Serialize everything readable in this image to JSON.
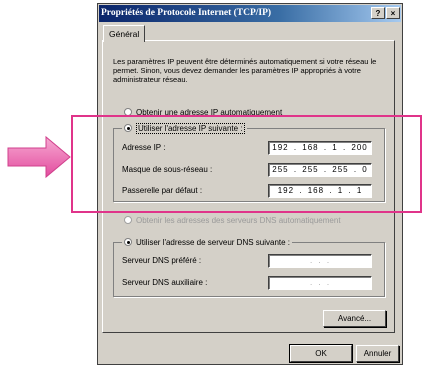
{
  "window": {
    "title": "Propriétés de Protocole Internet (TCP/IP)",
    "help_btn": "?",
    "close_btn": "×"
  },
  "tab": {
    "label": "Général"
  },
  "description": "Les paramètres IP peuvent être déterminés automatiquement si votre réseau le permet. Sinon, vous devez demander les paramètres IP appropriés à votre administrateur réseau.",
  "ip_mode": {
    "auto_label": "Obtenir une adresse IP automatiquement",
    "manual_label": "Utiliser l'adresse IP suivante :",
    "selected": "manual"
  },
  "ip_fields": {
    "address_label": "Adresse IP :",
    "address_value": "192 . 168 . 1 . 200",
    "mask_label": "Masque de sous-réseau :",
    "mask_value": "255 . 255 . 255 . 0",
    "gateway_label": "Passerelle par défaut :",
    "gateway_value": "192 . 168 . 1 . 1"
  },
  "dns_mode": {
    "auto_label": "Obtenir les adresses des serveurs DNS automatiquement",
    "manual_label": "Utiliser l'adresse de serveur DNS suivante :",
    "selected": "manual"
  },
  "dns_fields": {
    "preferred_label": "Serveur DNS préféré :",
    "preferred_value": ". . .",
    "alternate_label": "Serveur DNS auxiliaire :",
    "alternate_value": ". . ."
  },
  "buttons": {
    "advanced": "Avancé...",
    "ok": "OK",
    "cancel": "Annuler"
  },
  "colors": {
    "highlight": "#e0348a",
    "arrow": "#e85aa8"
  }
}
